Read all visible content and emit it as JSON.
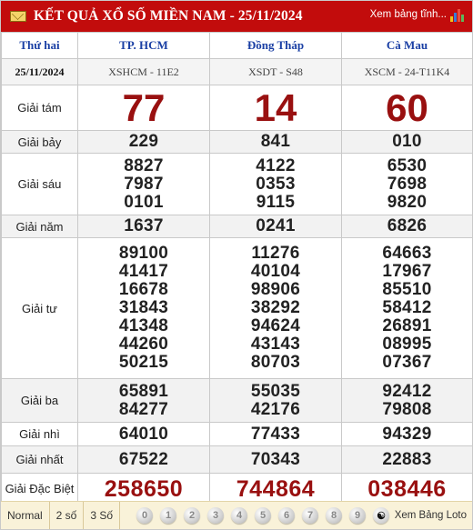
{
  "header": {
    "title": "KẾT QUẢ XỔ SỐ MIỀN NAM - 25/11/2024",
    "stats_link": "Xem bảng tĩnh...",
    "icon_mail": "mail-icon",
    "icon_chart": "bar-chart-icon"
  },
  "columns": {
    "day": "Thứ hai",
    "date": "25/11/2024",
    "provinces": [
      {
        "name": "TP. HCM",
        "code": "XSHCM - 11E2"
      },
      {
        "name": "Đồng Tháp",
        "code": "XSDT - S48"
      },
      {
        "name": "Cà Mau",
        "code": "XSCM - 24-T11K4"
      }
    ]
  },
  "prizes": {
    "g8": {
      "label": "Giải tám",
      "values": [
        "77",
        "14",
        "60"
      ]
    },
    "g7": {
      "label": "Giải bảy",
      "values": [
        "229",
        "841",
        "010"
      ]
    },
    "g6": {
      "label": "Giải sáu",
      "values": [
        [
          "8827",
          "7987",
          "0101"
        ],
        [
          "4122",
          "0353",
          "9115"
        ],
        [
          "6530",
          "7698",
          "9820"
        ]
      ]
    },
    "g5": {
      "label": "Giải năm",
      "values": [
        "1637",
        "0241",
        "6826"
      ]
    },
    "g4": {
      "label": "Giải tư",
      "values": [
        [
          "89100",
          "41417",
          "16678",
          "31843",
          "41348",
          "44260",
          "50215"
        ],
        [
          "11276",
          "40104",
          "98906",
          "38292",
          "94624",
          "43143",
          "80703"
        ],
        [
          "64663",
          "17967",
          "85510",
          "58412",
          "26891",
          "08995",
          "07367"
        ]
      ]
    },
    "g3": {
      "label": "Giải ba",
      "values": [
        [
          "65891",
          "84277"
        ],
        [
          "55035",
          "42176"
        ],
        [
          "92412",
          "79808"
        ]
      ]
    },
    "g2": {
      "label": "Giải nhì",
      "values": [
        "64010",
        "77433",
        "94329"
      ]
    },
    "g1": {
      "label": "Giải nhất",
      "values": [
        "67522",
        "70343",
        "22883"
      ]
    },
    "db": {
      "label": "Giải Đặc Biệt",
      "values": [
        "258650",
        "744864",
        "038446"
      ]
    }
  },
  "footer": {
    "tabs": [
      "Normal",
      "2 số",
      "3 Số"
    ],
    "digits": [
      "0",
      "1",
      "2",
      "3",
      "4",
      "5",
      "6",
      "7",
      "8",
      "9"
    ],
    "loto_link": "Xem Bảng Loto"
  },
  "colors": {
    "header_bg": "#c20c0c",
    "province_text": "#1a3fa4",
    "big_number": "#991010",
    "footer_bg": "#f9f2d9"
  }
}
